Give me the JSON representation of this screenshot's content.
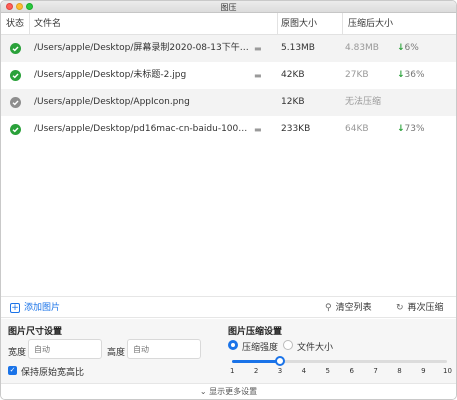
{
  "window": {
    "title": "图压"
  },
  "table": {
    "headers": {
      "status": "状态",
      "filename": "文件名",
      "original_size": "原图大小",
      "compressed_size": "压缩后大小"
    },
    "rows": [
      {
        "status": "success",
        "path": "/Users/apple/Desktop/屏幕录制2020-08-13下午…",
        "original": "5.13MB",
        "compressed": "4.83MB",
        "percent": "6%"
      },
      {
        "status": "success",
        "path": "/Users/apple/Desktop/未标题-2.jpg",
        "original": "42KB",
        "compressed": "27KB",
        "percent": "36%"
      },
      {
        "status": "skipped",
        "path": "/Users/apple/Desktop/AppIcon.png",
        "original": "12KB",
        "compressed": "无法压缩",
        "percent": ""
      },
      {
        "status": "success",
        "path": "/Users/apple/Desktop/pd16mac-cn-baidu-1000x…",
        "original": "233KB",
        "compressed": "64KB",
        "percent": "73%"
      }
    ]
  },
  "toolbar": {
    "add_label": "添加图片",
    "clear_label": "清空列表",
    "recompress_label": "再次压缩"
  },
  "size_settings": {
    "title": "图片尺寸设置",
    "width_label": "宽度",
    "width_placeholder": "自动",
    "height_label": "高度",
    "height_placeholder": "自动",
    "keep_ratio_label": "保持原始宽高比",
    "keep_ratio_checked": true
  },
  "compress_settings": {
    "title": "图片压缩设置",
    "mode_strength_label": "压缩强度",
    "mode_filesize_label": "文件大小",
    "selected_mode": "strength",
    "ticks": [
      "1",
      "2",
      "3",
      "4",
      "5",
      "6",
      "7",
      "8",
      "9",
      "10"
    ],
    "value": 3,
    "min": 1,
    "max": 10
  },
  "footer": {
    "more_label": "显示更多设置"
  },
  "colors": {
    "accent": "#1a73e8",
    "success": "#2aa13a",
    "skipped": "#8e8e8e"
  },
  "icons": [
    "check-circle-icon",
    "folder-icon",
    "down-arrow-icon",
    "plus-icon",
    "broom-icon",
    "refresh-icon",
    "chevron-down-icon"
  ]
}
